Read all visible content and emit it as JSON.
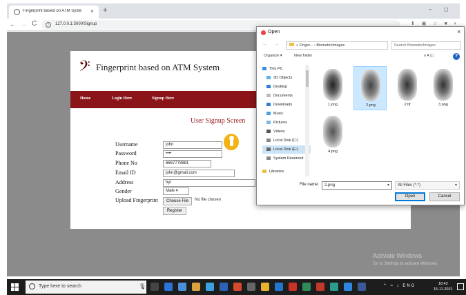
{
  "browser": {
    "tab_title": "Fingerprint based on ATM Syste",
    "tab_close": "×",
    "new_tab": "+",
    "url": "127.0.0.1:5000/Signup",
    "back": "←",
    "forward": "→",
    "reload": "C",
    "minimize": "–",
    "maximize": "◻",
    "extensions": "⬆ ▣ ☆ ■ ◐ ●"
  },
  "site": {
    "logo": "𝄢",
    "title": "Fingerprint based on ATM System",
    "nav": [
      "Home",
      "Login Here",
      "Signup Here"
    ],
    "form_title": "User Signup Screen"
  },
  "form": {
    "labels": [
      "Username",
      "Password",
      "Phone No",
      "Email ID",
      "Address",
      "Gender",
      "Upload Fingerprint"
    ],
    "username": "john",
    "password": "••••",
    "phone": "6667778881",
    "email": "john@gmail.com",
    "address": "hyl",
    "gender": "Male",
    "gender_caret": "▾",
    "choose_file": "Choose File",
    "no_file": "No file chosen",
    "register": "Register"
  },
  "dialog": {
    "title": "Open",
    "close": "×",
    "nav_arrows": "← → ↑",
    "path": "« Finger... › BiometricImages",
    "search_placeholder": "Search BiometricImages",
    "organize": "Organize ▾",
    "new_folder": "New folder",
    "help": "?",
    "view_icons": "≡ ▾ ◫",
    "nav_items": [
      "This PC",
      "3D Objects",
      "Desktop",
      "Documents",
      "Downloads",
      "Music",
      "Pictures",
      "Videos",
      "Local Disk (C:)",
      "Local Disk (E:)",
      "System Reserved",
      "Libraries"
    ],
    "nav_selected_index": 9,
    "files": [
      "1.png",
      "2.png",
      "2.tif",
      "3.png",
      "4.png"
    ],
    "selected_file_index": 1,
    "filename_label": "File name:",
    "filename": "2.png",
    "filetype": "All Files (*.*)",
    "open": "Open",
    "cancel": "Cancel"
  },
  "watermark": {
    "line1": "Activate Windows",
    "line2": "Go to Settings to activate Windows."
  },
  "taskbar": {
    "search_text": "Type here to search",
    "clock_time": "18:42",
    "clock_date": "15-11-2021",
    "tray": "⌃ ≈ ♪ ENG"
  },
  "colors": {
    "brand": "#8a1418",
    "accent": "#9b1b1f",
    "page_bg": "#8b8b8b"
  }
}
